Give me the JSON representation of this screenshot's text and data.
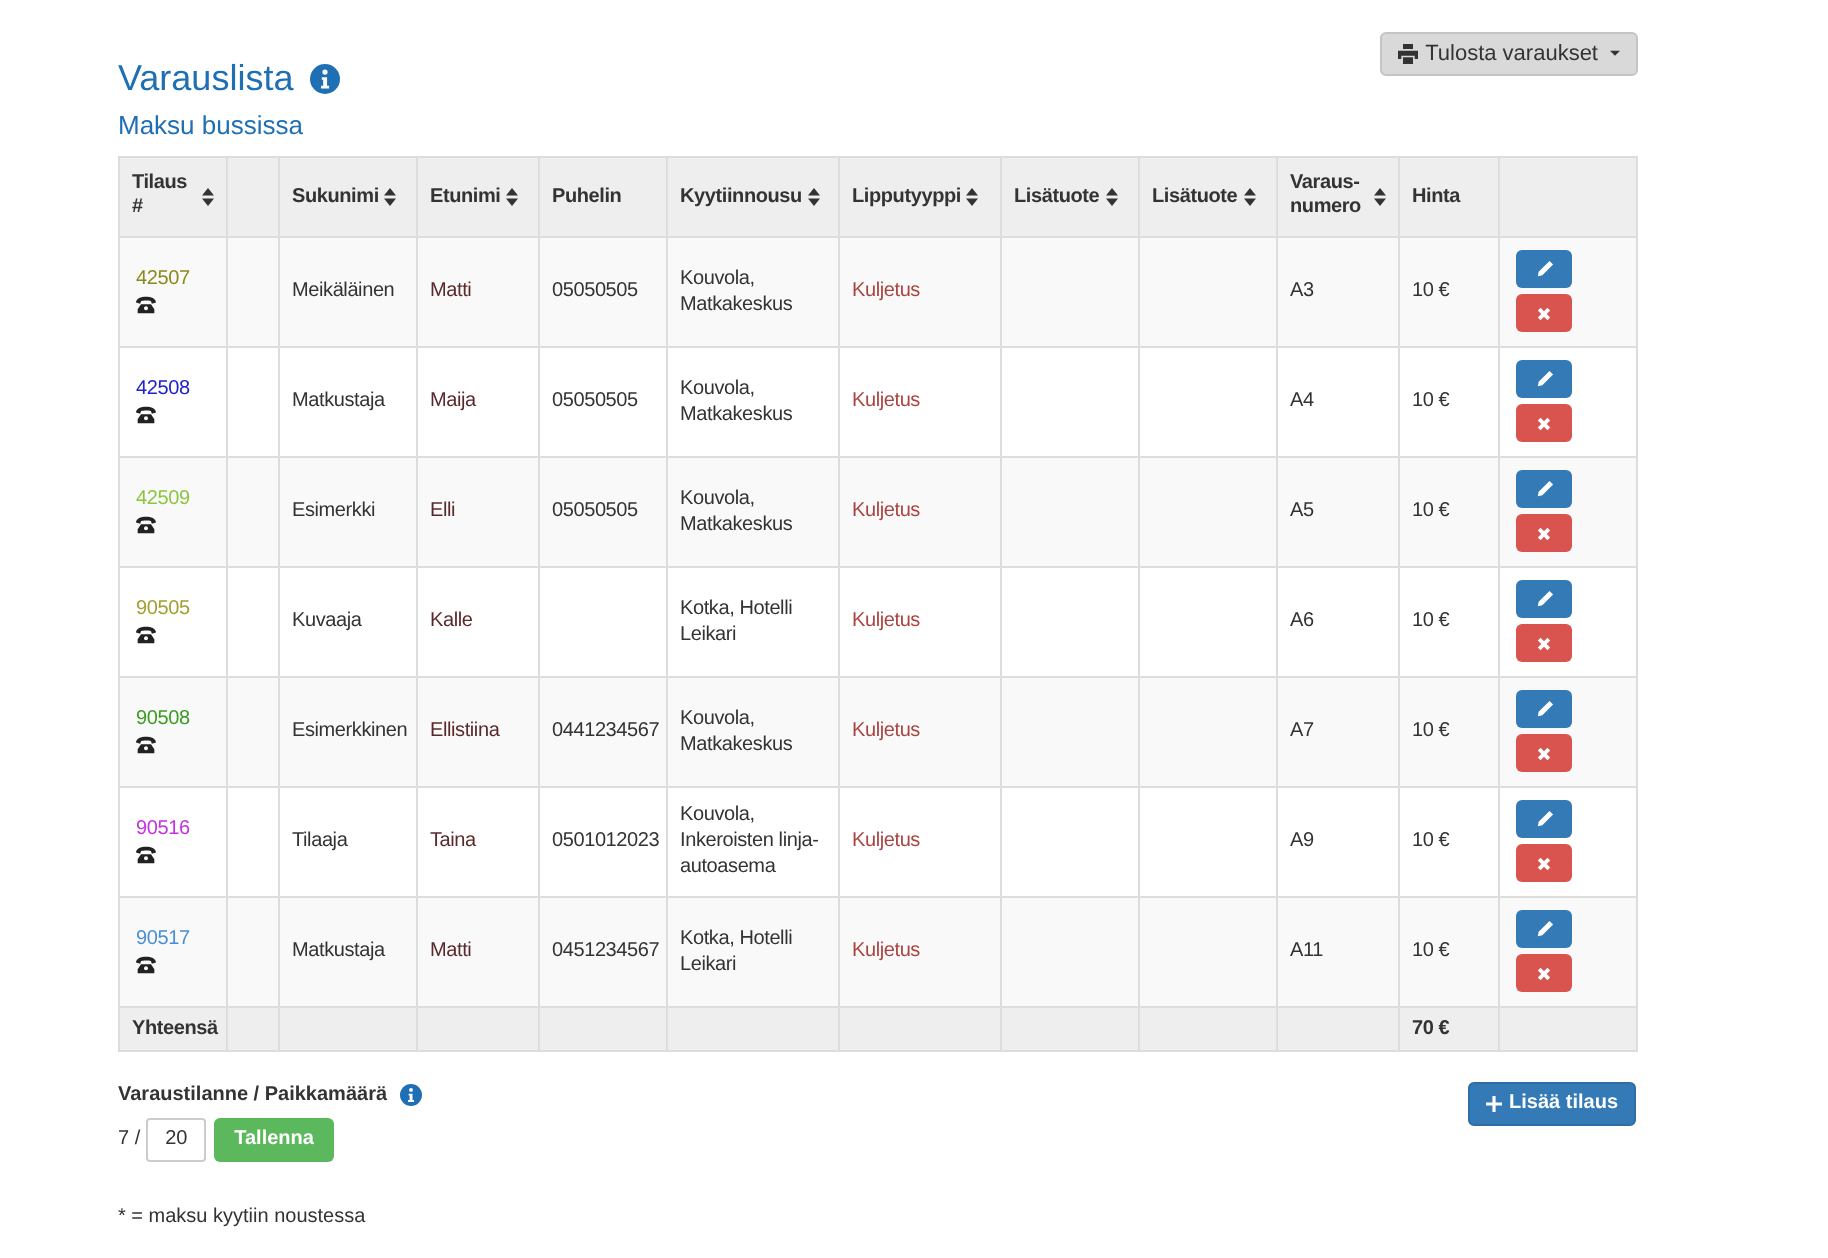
{
  "print_button": {
    "label": "Tulosta varaukset"
  },
  "title": "Varauslista",
  "subtitle": "Maksu bussissa",
  "table": {
    "columns": [
      {
        "label": "Tilaus #",
        "sortable": true
      },
      {
        "sortable": false
      },
      {
        "label": "Sukunimi",
        "sortable": true
      },
      {
        "label": "Etunimi",
        "sortable": true
      },
      {
        "label": "Puhelin",
        "sortable": false
      },
      {
        "label": "Kyytiinnousu",
        "sortable": true
      },
      {
        "label": "Lipputyyppi",
        "sortable": true
      },
      {
        "label": "Lisätuote",
        "sortable": true
      },
      {
        "label": "Lisätuote",
        "sortable": true
      },
      {
        "label": "Varaus-numero",
        "sortable": true
      },
      {
        "label": "Hinta",
        "sortable": false
      }
    ],
    "rows": [
      {
        "order": "42507",
        "color": "#8a8a1e",
        "last_name": "Meikäläinen",
        "first_name": "Matti",
        "phone": "05050505",
        "pickup": "Kouvola, Matkakeskus",
        "ticket_type": "Kuljetus",
        "seat": "A3",
        "price": "10 €"
      },
      {
        "order": "42508",
        "color": "#2222cc",
        "last_name": "Matkustaja",
        "first_name": "Maija",
        "phone": "05050505",
        "pickup": "Kouvola, Matkakeskus",
        "ticket_type": "Kuljetus",
        "seat": "A4",
        "price": "10 €"
      },
      {
        "order": "42509",
        "color": "#8cc63f",
        "last_name": "Esimerkki",
        "first_name": "Elli",
        "phone": "05050505",
        "pickup": "Kouvola, Matkakeskus",
        "ticket_type": "Kuljetus",
        "seat": "A5",
        "price": "10 €"
      },
      {
        "order": "90505",
        "color": "#a3a032",
        "last_name": "Kuvaaja",
        "first_name": "Kalle",
        "pickup": "Kotka, Hotelli Leikari",
        "ticket_type": "Kuljetus",
        "seat": "A6",
        "price": "10 €"
      },
      {
        "order": "90508",
        "color": "#3c9c22",
        "last_name": "Esimerkkinen",
        "first_name": "Ellistiina",
        "phone": "0441234567",
        "pickup": "Kouvola, Matkakeskus",
        "ticket_type": "Kuljetus",
        "seat": "A7",
        "price": "10 €"
      },
      {
        "order": "90516",
        "color": "#c531e0",
        "last_name": "Tilaaja",
        "first_name": "Taina",
        "phone": "0501012023",
        "pickup": "Kouvola, Inkeroisten linja-autoasema",
        "ticket_type": "Kuljetus",
        "seat": "A9",
        "price": "10 €"
      },
      {
        "order": "90517",
        "color": "#4a8fd4",
        "last_name": "Matkustaja",
        "first_name": "Matti",
        "phone": "0451234567",
        "pickup": "Kotka, Hotelli Leikari",
        "ticket_type": "Kuljetus",
        "seat": "A11",
        "price": "10 €"
      }
    ],
    "footer": {
      "label": "Yhteensä",
      "total": "70 €"
    }
  },
  "capacity": {
    "label": "Varaustilanne / Paikkamäärä",
    "count": "7 /",
    "value": "20",
    "save_button": "Tallenna"
  },
  "add_button": {
    "label": "Lisää tilaus"
  },
  "footnote": "* = maksu kyytiin noustessa"
}
